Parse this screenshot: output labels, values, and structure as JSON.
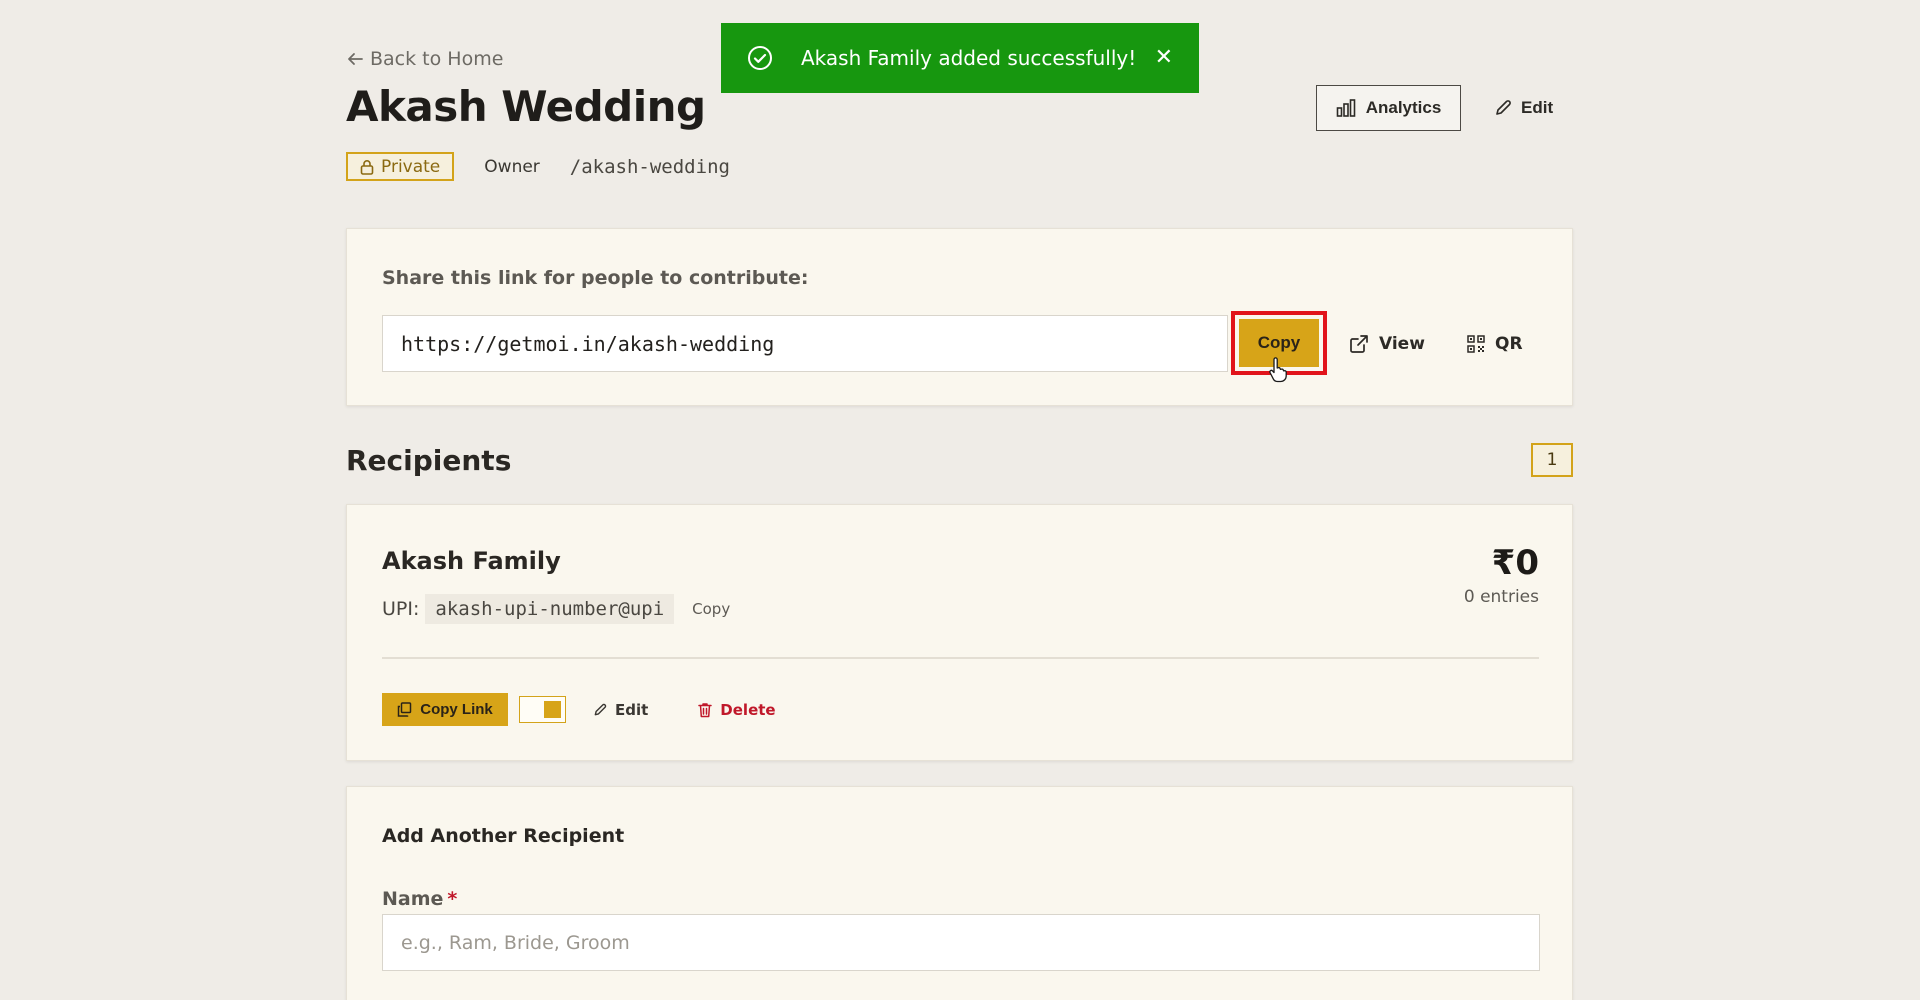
{
  "toast": {
    "message": "Akash Family added successfully!",
    "close_label": "✕",
    "color": "#17970f"
  },
  "header": {
    "back_label": "Back to Home",
    "title": "Akash Wedding",
    "privacy_badge": "Private",
    "role": "Owner",
    "slug": "/akash-wedding",
    "analytics_label": "Analytics",
    "edit_label": "Edit"
  },
  "share": {
    "label": "Share this link for people to contribute:",
    "url": "https://getmoi.in/akash-wedding",
    "copy_label": "Copy",
    "view_label": "View",
    "qr_label": "QR"
  },
  "recipients": {
    "title": "Recipients",
    "count": "1",
    "items": [
      {
        "name": "Akash Family",
        "upi_label": "UPI:",
        "upi": "akash-upi-number@upi",
        "upi_copy_label": "Copy",
        "amount": "₹0",
        "entries": "0 entries",
        "copy_link_label": "Copy Link",
        "edit_label": "Edit",
        "delete_label": "Delete"
      }
    ]
  },
  "add_recipient": {
    "title": "Add Another Recipient",
    "name_label": "Name",
    "required_mark": "*",
    "name_placeholder": "e.g., Ram, Bride, Groom",
    "name_value": ""
  },
  "colors": {
    "accent": "#d7a418",
    "danger": "#c0182a",
    "highlight": "#e1141b",
    "background": "#efece7"
  },
  "icons": {
    "toast": "check-circle-icon",
    "back": "arrow-left-icon",
    "privacy": "lock-icon",
    "analytics": "bar-chart-icon",
    "edit": "pencil-icon",
    "view": "external-link-icon",
    "qr": "qr-code-icon",
    "copy_link": "copy-icon",
    "delete": "trash-icon",
    "cursor": "hand-pointer-icon"
  }
}
